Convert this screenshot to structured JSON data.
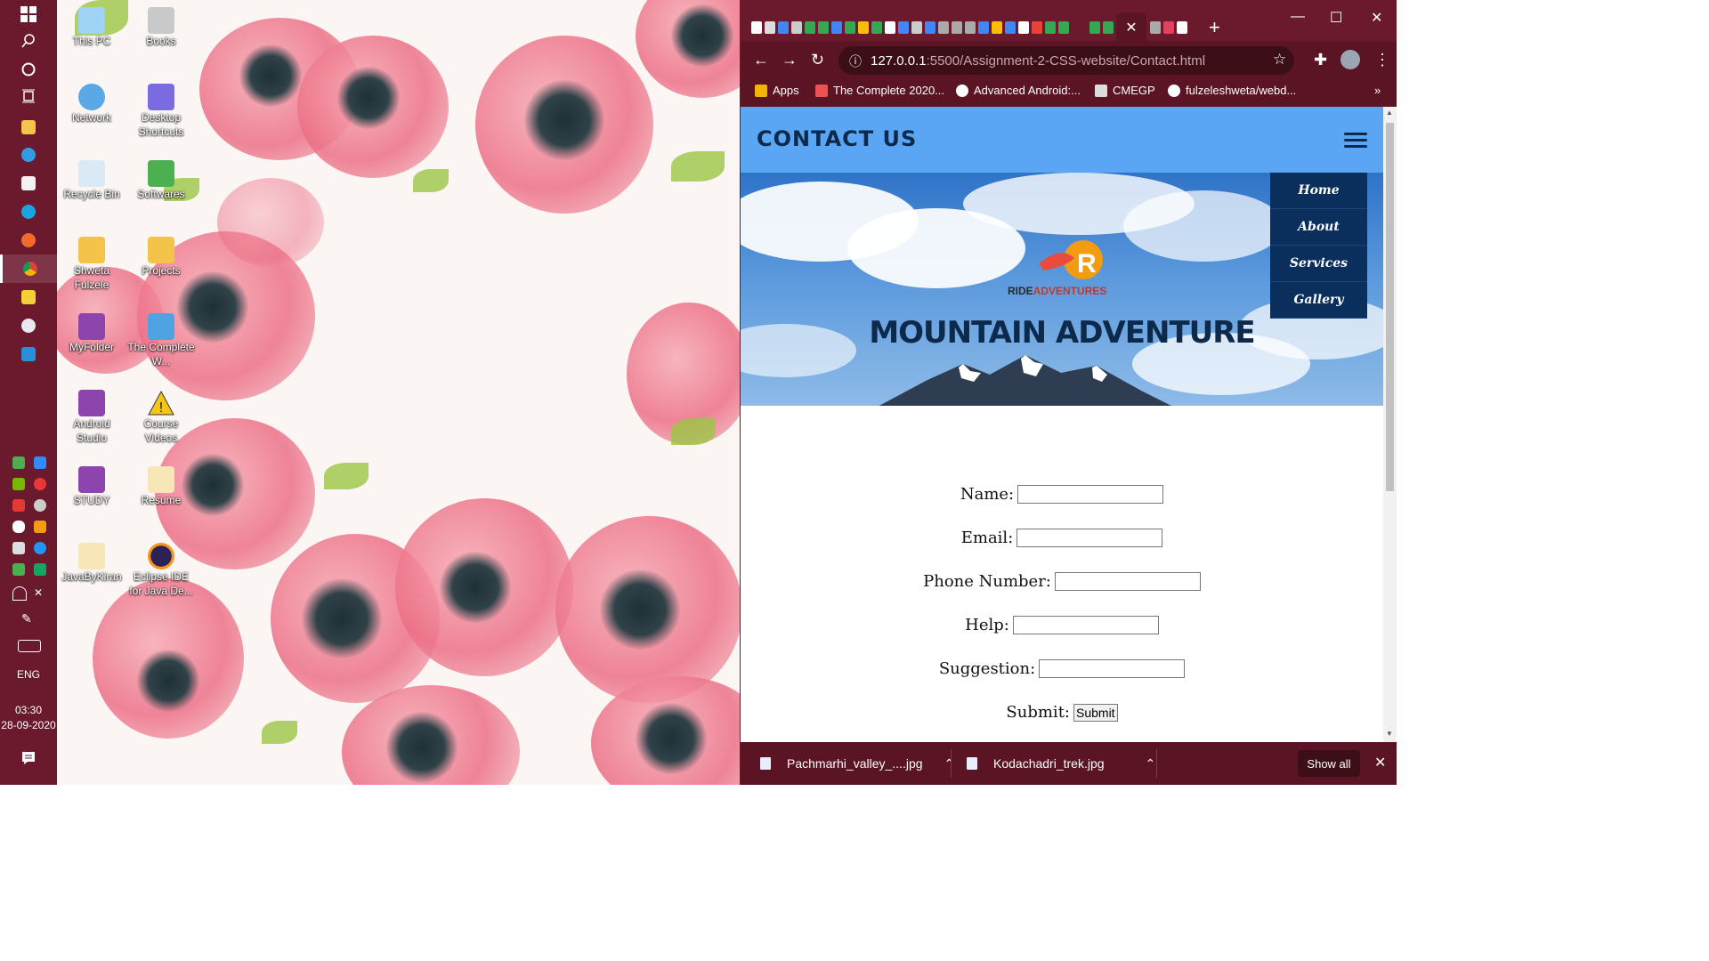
{
  "taskbar": {
    "language": "ENG",
    "time": "03:30",
    "date": "28-09-2020"
  },
  "desktop": {
    "icons": [
      {
        "label": "This PC"
      },
      {
        "label": "Books"
      },
      {
        "label": "Network"
      },
      {
        "label": "Desktop Shortcuts"
      },
      {
        "label": "Recycle Bin"
      },
      {
        "label": "Softwares"
      },
      {
        "label": "Shweta Fulzele"
      },
      {
        "label": "Projects"
      },
      {
        "label": "MyFolder"
      },
      {
        "label": "The Complete W..."
      },
      {
        "label": "Android Studio"
      },
      {
        "label": "Course Videos"
      },
      {
        "label": "STUDY"
      },
      {
        "label": "Resume"
      },
      {
        "label": "JavaByKiran"
      },
      {
        "label": "Eclipse IDE for Java De..."
      }
    ]
  },
  "browser": {
    "url_host": "127.0.0.1",
    "url_path": ":5500/Assignment-2-CSS-website/Contact.html",
    "bookmarks": [
      {
        "label": "Apps",
        "icon": "apps-grid-icon",
        "color": "#f4b400"
      },
      {
        "label": "The Complete 2020...",
        "icon": "udemy-icon",
        "color": "#ec5252"
      },
      {
        "label": "Advanced Android:...",
        "icon": "course-icon",
        "color": "#ffffff"
      },
      {
        "label": "CMEGP",
        "icon": "cmegp-icon",
        "color": "#dddddd"
      },
      {
        "label": "fulzeleshweta/webd...",
        "icon": "github-icon",
        "color": "#ffffff"
      }
    ],
    "more_bookmarks": "»"
  },
  "page": {
    "header_title": "CONTACT US",
    "logo_text_dark": "RIDE",
    "logo_text_brand": "ADVENTURES",
    "banner_heading": "MOUNTAIN ADVENTURE",
    "nav": [
      "Home",
      "About",
      "Services",
      "Gallery"
    ],
    "form": {
      "name_label": "Name:",
      "email_label": "Email:",
      "phone_label": "Phone Number:",
      "help_label": "Help:",
      "suggestion_label": "Suggestion:",
      "submit_label": "Submit:",
      "submit_button": "Submit"
    },
    "colors": {
      "header": "#5aa6f4",
      "nav": "#0b2f5c",
      "heading_text": "#0d2a4a"
    }
  },
  "downloads": {
    "items": [
      {
        "name": "Pachmarhi_valley_....jpg"
      },
      {
        "name": "Kodachadri_trek.jpg"
      }
    ],
    "show_all": "Show all"
  }
}
